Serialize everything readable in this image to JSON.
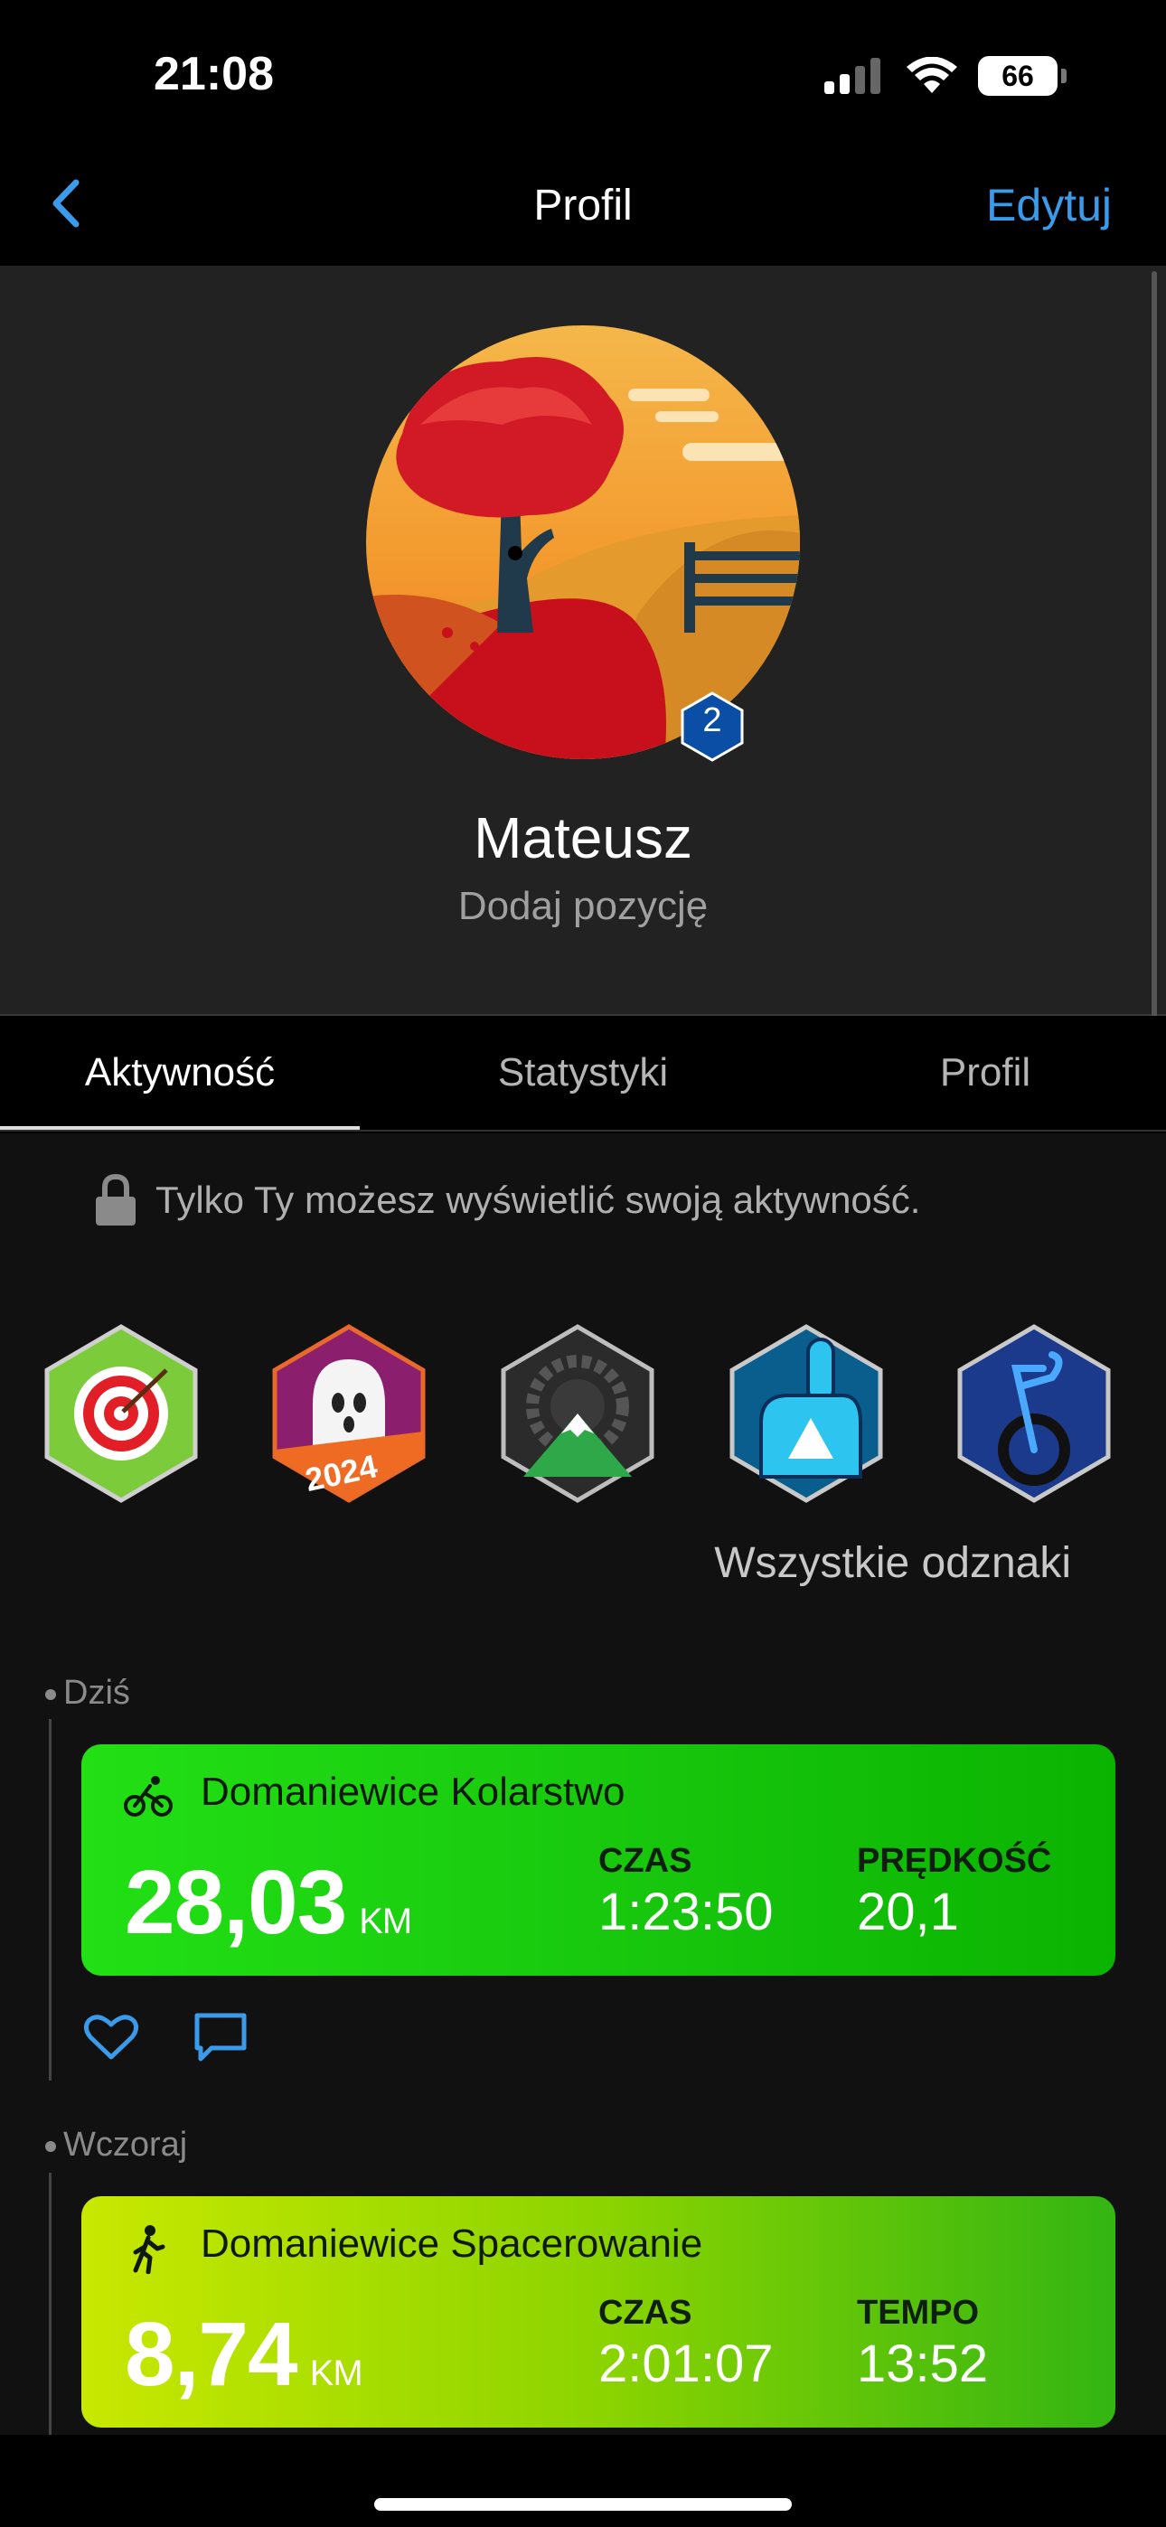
{
  "status_bar": {
    "time": "21:08",
    "battery": "66"
  },
  "nav": {
    "title": "Profil",
    "edit_label": "Edytuj"
  },
  "profile": {
    "name": "Mateusz",
    "position_placeholder": "Dodaj pozycję",
    "level": "2"
  },
  "tabs": [
    {
      "label": "Aktywność",
      "active": true
    },
    {
      "label": "Statystyki",
      "active": false
    },
    {
      "label": "Profil",
      "active": false
    }
  ],
  "privacy_note": "Tylko Ty możesz wyświetlić swoją aktywność.",
  "badges": [
    {
      "icon": "target-badge-icon"
    },
    {
      "icon": "ghost-2024-badge-icon",
      "text": "2024"
    },
    {
      "icon": "mountain-chainring-badge-icon"
    },
    {
      "icon": "foam-finger-badge-icon"
    },
    {
      "icon": "bike-wheel-badge-icon"
    }
  ],
  "all_badges_label": "Wszystkie odznaki",
  "timeline": [
    {
      "day": "Dziś",
      "activity": {
        "type_icon": "cycling-icon",
        "title": "Domaniewice Kolarstwo",
        "distance": "28,03",
        "unit": "KM",
        "metric1_label": "CZAS",
        "metric1_value": "1:23:50",
        "metric2_label": "PRĘDKOŚĆ",
        "metric2_value": "20,1"
      }
    },
    {
      "day": "Wczoraj",
      "activity": {
        "type_icon": "walking-icon",
        "title": "Domaniewice Spacerowanie",
        "distance": "8,74",
        "unit": "KM",
        "metric1_label": "CZAS",
        "metric1_value": "2:01:07",
        "metric2_label": "TEMPO",
        "metric2_value": "13:52"
      }
    }
  ],
  "colors": {
    "accent": "#3a9bea",
    "bike_card": "#16c40c",
    "walk_card": "#8cd400"
  }
}
